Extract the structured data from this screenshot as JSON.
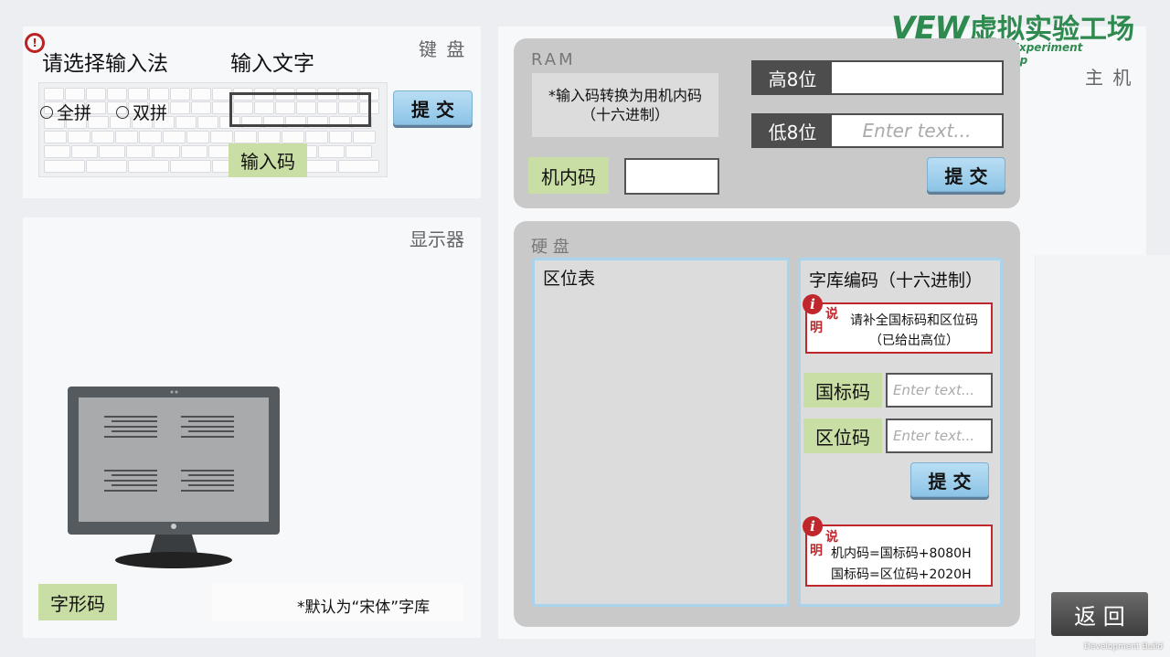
{
  "brand": {
    "logo_left": "VEW",
    "logo_cn": "虚拟实验工场",
    "logo_en": "Virtual Experiment Workshop"
  },
  "keyboard_panel": {
    "title": "键 盘",
    "heading": "请选择输入法",
    "input_text_label": "输入文字",
    "radio_quanpin": "全拼",
    "radio_shuangpin": "双拼",
    "input_code_label": "输入码",
    "submit_label": "提 交"
  },
  "display_panel": {
    "title": "显示器",
    "glyph_code_label": "字形码",
    "default_font_note": "*默认为“宋体”字库"
  },
  "host_panel": {
    "title": "主 机"
  },
  "ram": {
    "title": "RAM",
    "hint": "*输入码转换为用机内码\n（十六进制）",
    "high8_label": "高8位",
    "low8_label": "低8位",
    "low8_placeholder": "Enter text...",
    "internal_code_label": "机内码",
    "submit_label": "提 交"
  },
  "disk": {
    "title": "硬 盘",
    "zone_table_title": "区位表",
    "font_code_title": "字库编码（十六进制）",
    "note1_char1": "说",
    "note1_char2": "明",
    "note1_text": "请补全国标码和区位码\n（已给出高位）",
    "gb_code_label": "国标码",
    "gb_placeholder": "Enter text...",
    "zone_code_label": "区位码",
    "zone_placeholder": "Enter text...",
    "submit_label": "提 交",
    "note2_char1": "说",
    "note2_char2": "明",
    "note2_line1": "机内码=国标码+8080H",
    "note2_line2": "国标码=区位码+2020H"
  },
  "footer": {
    "back_label": "返 回",
    "build_text": "Development Build"
  },
  "colors": {
    "accent_blue": "#8cc4e6",
    "label_green": "#c9dea4",
    "note_red": "#c0272d"
  }
}
